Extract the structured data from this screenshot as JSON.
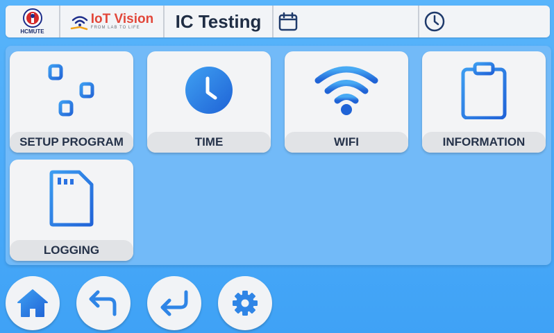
{
  "header": {
    "logo1_text": "HCMUTE",
    "logo2_main": "IoT Vision",
    "logo2_sub": "FROM LAB TO LIFE",
    "title": "IC Testing",
    "date_icon": "calendar-icon",
    "time_icon": "clock-icon"
  },
  "tiles": [
    {
      "label": "SETUP PROGRAM",
      "icon": "sliders-icon"
    },
    {
      "label": "TIME",
      "icon": "clock-icon"
    },
    {
      "label": "WIFI",
      "icon": "wifi-icon"
    },
    {
      "label": "INFORMATION",
      "icon": "clipboard-icon"
    },
    {
      "label": "LOGGING",
      "icon": "sd-card-icon"
    }
  ],
  "nav": [
    {
      "icon": "home-icon"
    },
    {
      "icon": "back-arrow-icon"
    },
    {
      "icon": "enter-icon"
    },
    {
      "icon": "gear-icon"
    }
  ],
  "colors": {
    "background": "#4aa8f8",
    "panel": "#72baf8",
    "icon_blue": "#2f7de6",
    "header_text": "#1f2d44"
  }
}
